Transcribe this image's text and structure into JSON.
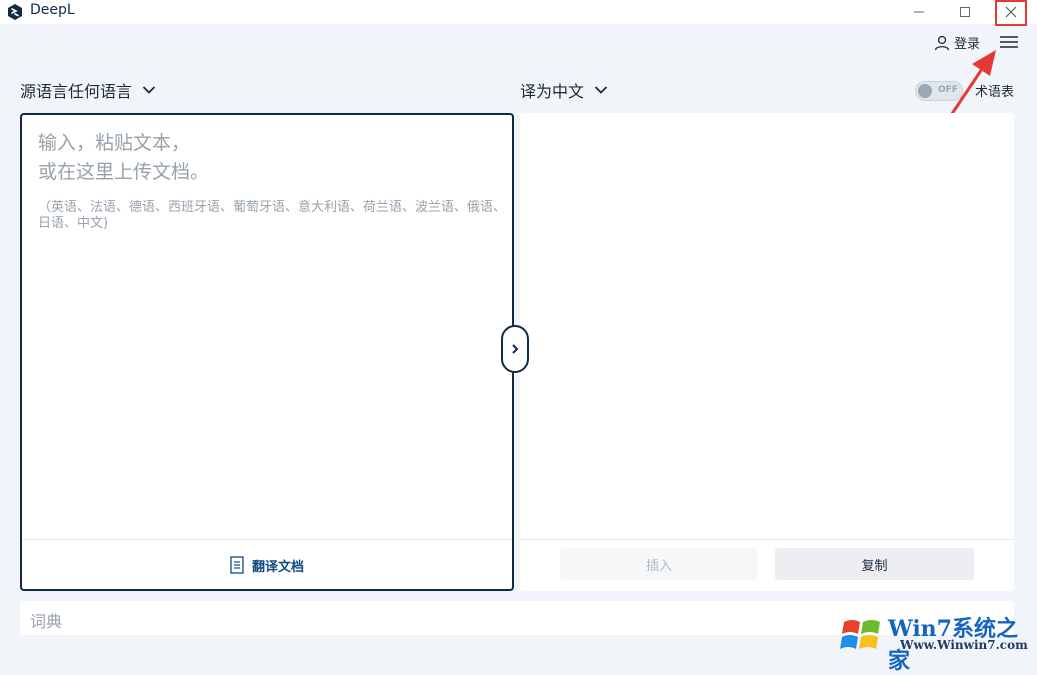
{
  "window": {
    "title": "DeepL",
    "minimize_icon": "minimize-icon",
    "maximize_icon": "maximize-icon",
    "close_icon": "close-icon"
  },
  "header": {
    "login_label": "登录",
    "menu_icon": "hamburger-menu-icon"
  },
  "source": {
    "language_label": "源语言任何语言",
    "placeholder_line1": "输入，粘贴文本，",
    "placeholder_line2": "或在这里上传文档。",
    "supported_languages": "（英语、法语、德语、西班牙语、葡萄牙语、意大利语、荷兰语、波兰语、俄语、日语、中文)",
    "translate_document_label": "翻译文档"
  },
  "target": {
    "language_label": "译为中文",
    "glossary_toggle_state": "OFF",
    "glossary_label": "术语表",
    "insert_label": "插入",
    "copy_label": "复制"
  },
  "dictionary": {
    "label": "词典"
  },
  "watermark": {
    "line1": "Win7系统之家",
    "line2": "Www.Winwin7.com"
  },
  "colors": {
    "brand": "#0f2b46",
    "accent": "#0f4c81",
    "highlight": "#e53935",
    "background": "#f1f5f9"
  }
}
